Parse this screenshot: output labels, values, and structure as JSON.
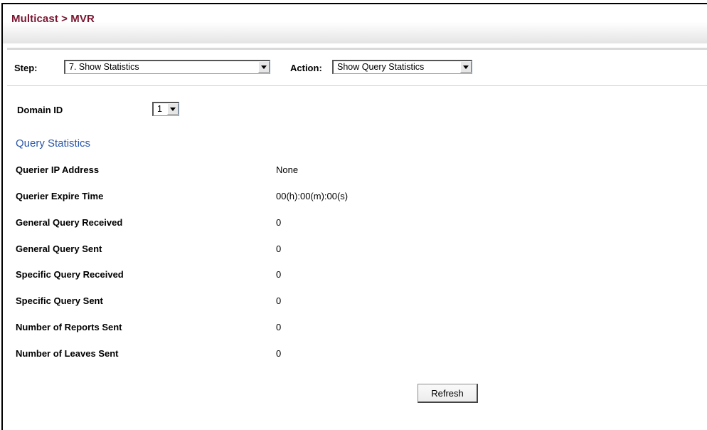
{
  "header": {
    "title": "Multicast > MVR"
  },
  "step": {
    "label": "Step:",
    "selected": "7. Show Statistics"
  },
  "action": {
    "label": "Action:",
    "selected": "Show Query Statistics"
  },
  "domain": {
    "label": "Domain ID",
    "selected": "1"
  },
  "section": {
    "title": "Query Statistics"
  },
  "stats": [
    {
      "label": "Querier IP Address",
      "value": "None"
    },
    {
      "label": "Querier Expire Time",
      "value": "00(h):00(m):00(s)"
    },
    {
      "label": "General Query Received",
      "value": "0"
    },
    {
      "label": "General Query Sent",
      "value": "0"
    },
    {
      "label": "Specific Query Received",
      "value": "0"
    },
    {
      "label": "Specific Query Sent",
      "value": "0"
    },
    {
      "label": "Number of Reports Sent",
      "value": "0"
    },
    {
      "label": "Number of Leaves Sent",
      "value": "0"
    }
  ],
  "buttons": {
    "refresh": "Refresh"
  },
  "colors": {
    "title": "#7a1530",
    "section_title": "#2a58a8"
  }
}
